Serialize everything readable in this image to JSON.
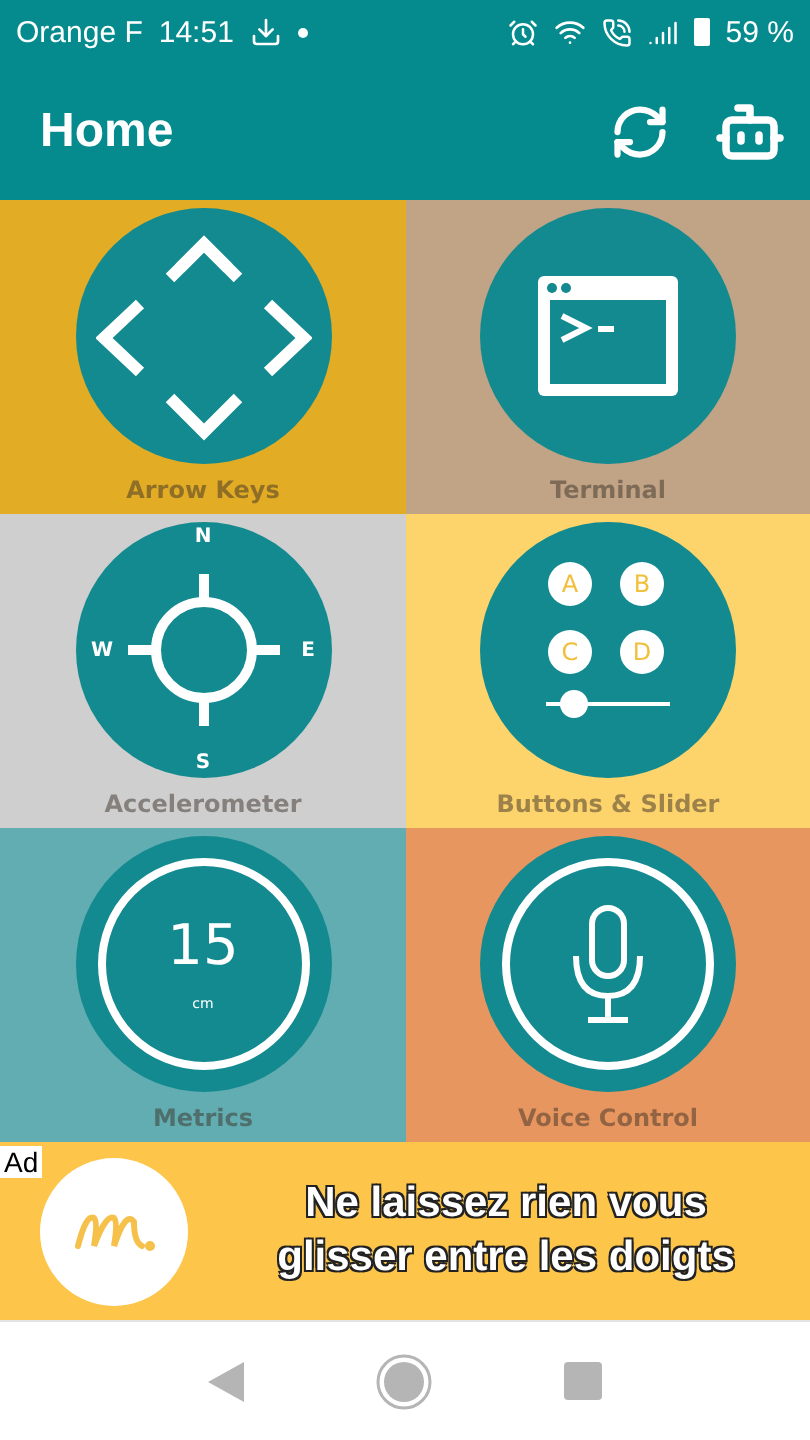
{
  "status_bar": {
    "carrier": "Orange F",
    "time": "14:51",
    "battery": "59 %"
  },
  "app_bar": {
    "title": "Home"
  },
  "tiles": [
    {
      "kind": "arrows",
      "label": "Arrow Keys",
      "color": "#e3ac25"
    },
    {
      "kind": "terminal",
      "label": "Terminal",
      "color": "#c1a486"
    },
    {
      "kind": "compass",
      "label": "Accelerometer",
      "color": "#cfcfcf",
      "glyphs": [
        "N",
        "E",
        "S",
        "W"
      ]
    },
    {
      "kind": "buttons",
      "label": "Buttons & Slider",
      "color": "#fdd36c",
      "glyphs": [
        "A",
        "B",
        "C",
        "D"
      ]
    },
    {
      "kind": "metric",
      "label": "Metrics",
      "color": "#62adb1",
      "value": "15",
      "unit": "cm"
    },
    {
      "kind": "mic",
      "label": "Voice Control",
      "color": "#e8965f"
    }
  ],
  "ad": {
    "badge": "Ad",
    "text": "Ne laissez rien vous glisser entre les doigts"
  }
}
